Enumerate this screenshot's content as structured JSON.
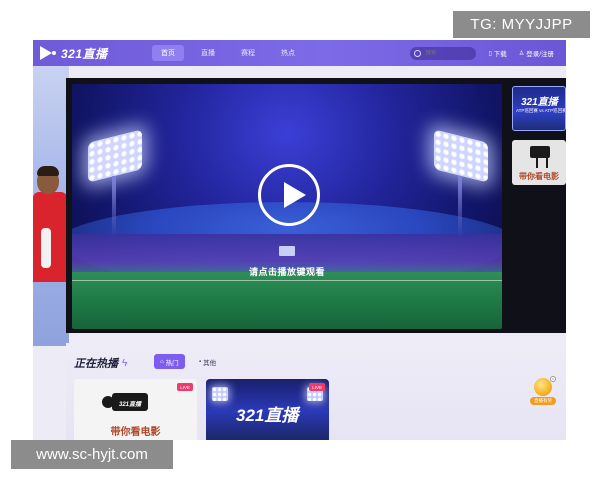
{
  "site": {
    "logo_text": "321直播"
  },
  "nav": {
    "tabs": [
      {
        "label": "首页",
        "active": true
      },
      {
        "label": "直播",
        "active": false
      },
      {
        "label": "赛程",
        "active": false
      },
      {
        "label": "热点",
        "active": false
      }
    ],
    "search_placeholder": "搜索",
    "download_label": "下载",
    "login_label": "登录/注册"
  },
  "player": {
    "play_hint": "请点击播放键观看"
  },
  "side_thumbs": [
    {
      "logo": "321直播",
      "caption": "ATP巡回赛 vs ATP巡回赛"
    },
    {
      "movie_text": "带你看电影"
    }
  ],
  "hot": {
    "title": "正在热播",
    "filter_hot": "热门",
    "filter_other": "其他",
    "cards": [
      {
        "badge": "LIVE",
        "camera_label": "321直播",
        "movie_text": "带你看电影"
      },
      {
        "badge": "LIVE",
        "logo": "321直播"
      }
    ]
  },
  "float_widget": {
    "label": "直播有奖"
  },
  "watermarks": {
    "top": "TG: MYYJJPP",
    "bottom": "www.sc-hyjt.com"
  },
  "colors": {
    "nav": "#7d6ae6",
    "accent": "#7d5cf0",
    "live": "#ec3b6c"
  },
  "icons": [
    "logo-play-icon",
    "search-icon",
    "download-icon",
    "user-icon",
    "play-icon",
    "fire-icon",
    "grid-icon",
    "camera-icon",
    "coin-icon",
    "close-icon"
  ]
}
